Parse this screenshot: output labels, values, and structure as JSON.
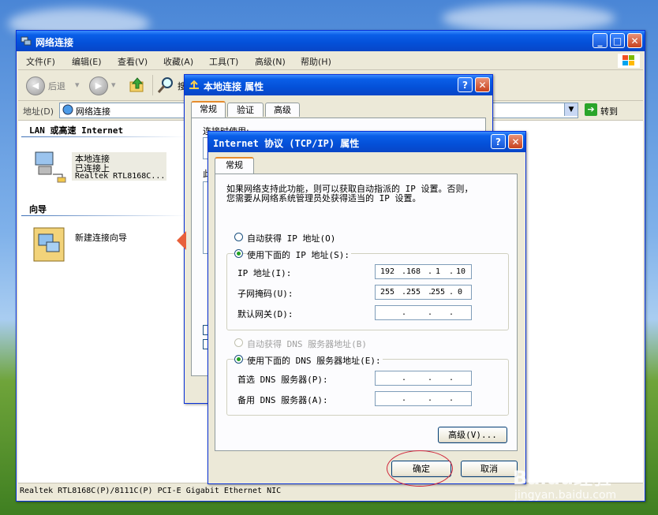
{
  "explorer": {
    "title": "网络连接",
    "menu": [
      "文件(F)",
      "编辑(E)",
      "查看(V)",
      "收藏(A)",
      "工具(T)",
      "高级(N)",
      "帮助(H)"
    ],
    "toolbar": {
      "back": "后退",
      "search_partial": "搜"
    },
    "address": {
      "label": "地址(D)",
      "value": "网络连接",
      "go": "转到"
    },
    "lan_group": "LAN 或高速 Internet",
    "connection": {
      "name": "本地连接",
      "status": "已连接上",
      "adapter": "Realtek RTL8168C..."
    },
    "wizard_group": "向导",
    "wizard_item": "新建连接向导",
    "status_text": "Realtek RTL8168C(P)/8111C(P) PCI-E Gigabit Ethernet NIC"
  },
  "props_dialog": {
    "title": "本地连接 属性",
    "tabs": [
      "常规",
      "验证",
      "高级"
    ],
    "connect_using": "连接时使用:",
    "partial_char": "此"
  },
  "tcpip_dialog": {
    "title": "Internet 协议 (TCP/IP) 属性",
    "tab": "常规",
    "description_line1": "如果网络支持此功能，则可以获取自动指派的 IP 设置。否则，",
    "description_line2": "您需要从网络系统管理员处获得适当的 IP 设置。",
    "auto_ip": "自动获得 IP 地址(O)",
    "manual_ip": "使用下面的 IP 地址(S):",
    "ip_label": "IP 地址(I):",
    "mask_label": "子网掩码(U):",
    "gateway_label": "默认网关(D):",
    "ip_value": [
      "192",
      "168",
      "1",
      "10"
    ],
    "mask_value": [
      "255",
      "255",
      "255",
      "0"
    ],
    "auto_dns": "自动获得 DNS 服务器地址(B)",
    "manual_dns": "使用下面的 DNS 服务器地址(E):",
    "dns1_label": "首选 DNS 服务器(P):",
    "dns2_label": "备用 DNS 服务器(A):",
    "advanced_button": "高级(V)...",
    "ok_button": "确定",
    "cancel_button": "取消"
  },
  "watermark": {
    "brand": "Baidu经验",
    "url": "jingyan.baidu.com"
  }
}
